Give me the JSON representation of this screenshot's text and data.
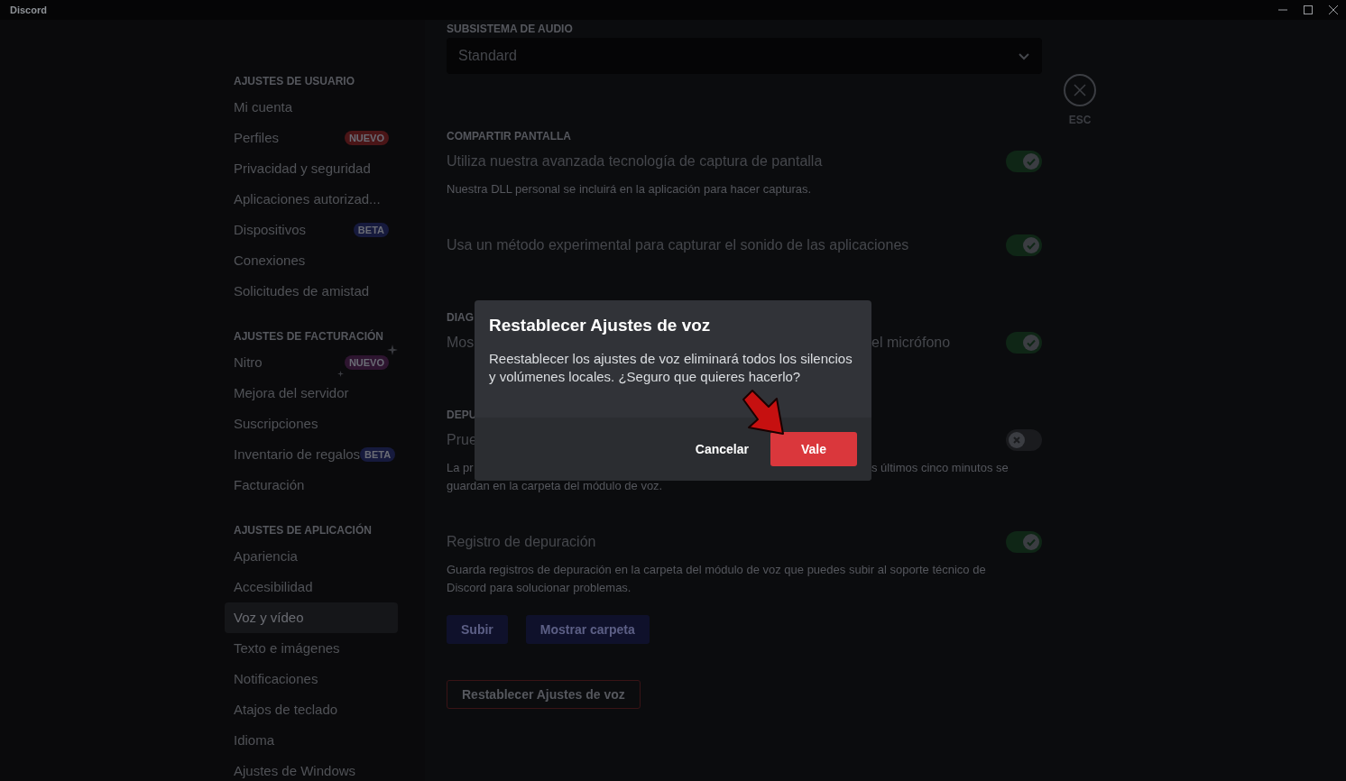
{
  "window": {
    "title": "Discord"
  },
  "sidebar": {
    "sections": [
      {
        "header": "AJUSTES DE USUARIO",
        "items": [
          {
            "label": "Mi cuenta",
            "selected": false
          },
          {
            "label": "Perfiles",
            "selected": false,
            "badge": {
              "text": "NUEVO",
              "color": "#4a1517",
              "kind": "plain"
            }
          },
          {
            "label": "Privacidad y seguridad",
            "selected": false
          },
          {
            "label": "Aplicaciones autorizad...",
            "selected": false
          },
          {
            "label": "Dispositivos",
            "selected": false,
            "badge": {
              "text": "BETA",
              "color": "#161a3d",
              "kind": "plain"
            }
          },
          {
            "label": "Conexiones",
            "selected": false
          },
          {
            "label": "Solicitudes de amistad",
            "selected": false
          }
        ]
      },
      {
        "header": "AJUSTES DE FACTURACIÓN",
        "items": [
          {
            "label": "Nitro",
            "selected": false,
            "badge": {
              "text": "NUEVO",
              "color": "#2e1530",
              "kind": "sparkle"
            }
          },
          {
            "label": "Mejora del servidor",
            "selected": false
          },
          {
            "label": "Suscripciones",
            "selected": false
          },
          {
            "label": "Inventario de regalos",
            "selected": false,
            "badge": {
              "text": "BETA",
              "color": "#161a3d",
              "kind": "plain"
            }
          },
          {
            "label": "Facturación",
            "selected": false
          }
        ]
      },
      {
        "header": "AJUSTES DE APLICACIÓN",
        "items": [
          {
            "label": "Apariencia",
            "selected": false
          },
          {
            "label": "Accesibilidad",
            "selected": false
          },
          {
            "label": "Voz y vídeo",
            "selected": true
          },
          {
            "label": "Texto e imágenes",
            "selected": false
          },
          {
            "label": "Notificaciones",
            "selected": false
          },
          {
            "label": "Atajos de teclado",
            "selected": false
          },
          {
            "label": "Idioma",
            "selected": false
          },
          {
            "label": "Ajustes de Windows",
            "selected": false
          }
        ]
      }
    ]
  },
  "content": {
    "audio_subsystem": {
      "header": "SUBSISTEMA DE AUDIO",
      "value": "Standard"
    },
    "sections": [
      {
        "header": "COMPARTIR PANTALLA",
        "rows": [
          {
            "title": [
              "Utiliza nuestra avanzada tecnología de captura de pantalla"
            ],
            "description": [
              [
                "Nuestra DLL personal se incluirá en la aplicación para hacer capturas."
              ]
            ],
            "on": true
          },
          {
            "title": [
              "Usa un método experimental para capturar el sonido de las aplicaciones"
            ],
            "on": true
          }
        ]
      },
      {
        "header": "DIAG",
        "rows": [
          {
            "title": [
              "Mos",
              "el micrófono"
            ],
            "on": true
          }
        ]
      },
      {
        "header": "DEPU",
        "rows": [
          {
            "title": [
              "Prue"
            ],
            "description": [
              [
                "La pr",
                "s últimos cinco minutos se"
              ],
              [
                "guardan en la carpeta del módulo de voz."
              ]
            ],
            "on": false
          },
          {
            "title": [
              "Registro de depuración"
            ],
            "description": [
              [
                "Guarda registros de depuración en la carpeta del módulo de voz que puedes subir al soporte técnico de"
              ],
              [
                "Discord para solucionar problemas."
              ]
            ],
            "on": true,
            "buttons": [
              "Subir",
              "Mostrar carpeta"
            ]
          }
        ]
      }
    ],
    "reset_button": "Restablecer Ajustes de voz"
  },
  "close": {
    "label": "ESC"
  },
  "dialog": {
    "title": "Restablecer Ajustes de voz",
    "body": "Reestablecer los ajustes de voz eliminará todos los silencios y volúmenes locales. ¿Seguro que quieres hacerlo?",
    "cancel": "Cancelar",
    "confirm": "Vale"
  }
}
